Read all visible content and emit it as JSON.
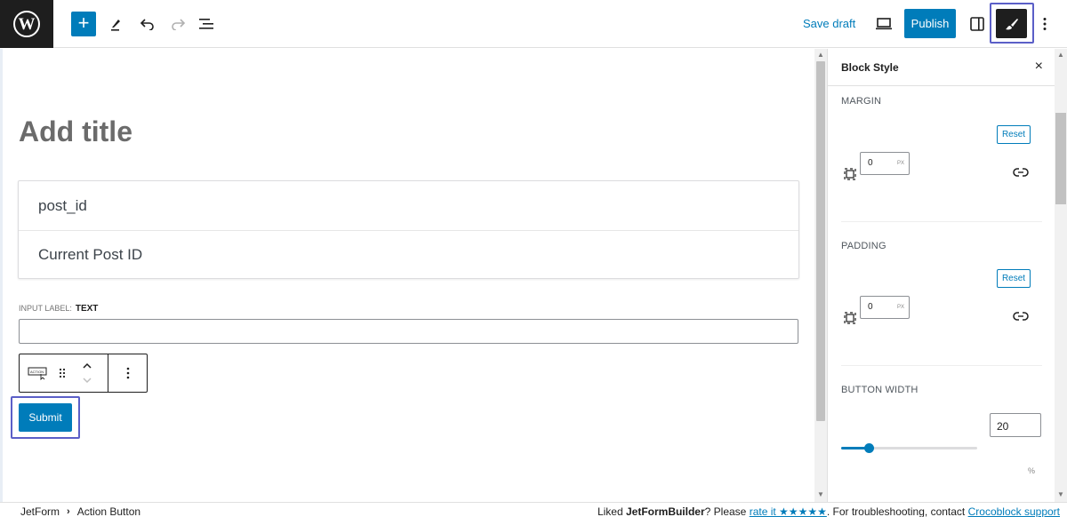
{
  "colors": {
    "accent": "#007cba",
    "highlight": "#5b5fc7",
    "dark": "#1e1e1e"
  },
  "topbar": {
    "logo_icon": "wordpress-logo-icon",
    "logo_glyph": "W",
    "add_label": "+",
    "save_draft": "Save draft",
    "publish": "Publish"
  },
  "editor": {
    "title_placeholder": "Add title",
    "hidden_fields": [
      "post_id",
      "Current Post ID"
    ],
    "input_label_prefix": "INPUT LABEL:",
    "input_label_value": "TEXT",
    "submit": "Submit",
    "action_icon_text": "ACTION"
  },
  "sidebar": {
    "title": "Block Style",
    "close": "×",
    "margin": {
      "label": "MARGIN",
      "reset": "Reset",
      "value": "0",
      "unit": "PX"
    },
    "padding": {
      "label": "PADDING",
      "reset": "Reset",
      "value": "0",
      "unit": "PX"
    },
    "button_width": {
      "label": "BUTTON WIDTH",
      "value": "20",
      "unit": "%",
      "fraction": 0.2
    }
  },
  "footer": {
    "breadcrumb": [
      "JetForm",
      "Action Button"
    ],
    "breadcrumb_sep": "›",
    "notice_prefix": "Liked ",
    "notice_brand": "JetFormBuilder",
    "notice_mid": "? Please ",
    "rate_link": "rate it ★★★★★",
    "notice_after": ". For troubleshooting, contact ",
    "support_link": "Crocoblock support"
  }
}
